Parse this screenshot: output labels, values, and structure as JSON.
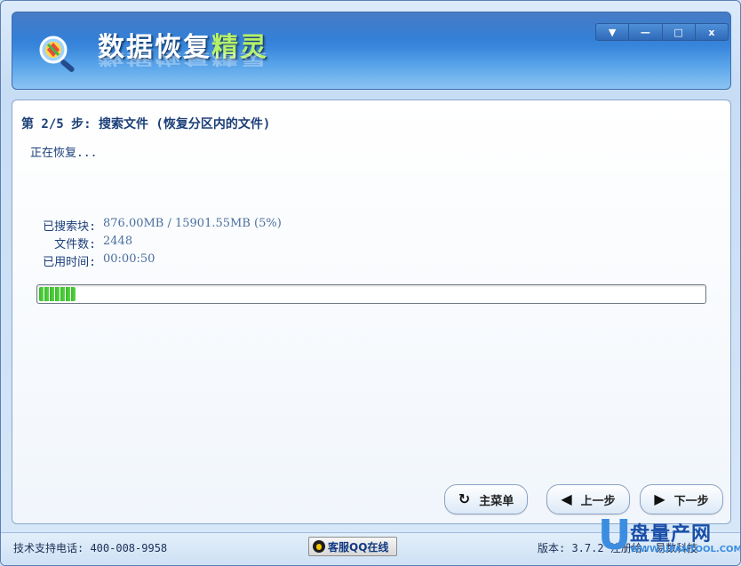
{
  "window": {
    "app_title_main": "数据恢复",
    "app_title_accent": "精灵",
    "controls": [
      "▼",
      "—",
      "□",
      "x"
    ]
  },
  "step": {
    "title": "第 2/5 步: 搜索文件 (恢复分区内的文件)",
    "status": "正在恢复..."
  },
  "info": {
    "searched_label": "已搜索块:",
    "searched_value": "876.00MB / 15901.55MB (5%)",
    "files_label": "文件数:",
    "files_value": "2448",
    "elapsed_label": "已用时间:",
    "elapsed_value": "00:00:50"
  },
  "progress": {
    "fraction": 0.055
  },
  "buttons": {
    "main_menu": "主菜单",
    "prev": "上一步",
    "next": "下一步"
  },
  "footer": {
    "support": "技术支持电话: 400-008-9958",
    "qq": "客服QQ在线",
    "version": "版本: 3.7.2  注册给: 易数科技"
  },
  "watermark": {
    "letter": "U",
    "text": "盘量产网",
    "url": "WWW.UPANTOOL.COM"
  },
  "colors": {
    "accent": "#b6f06a",
    "title_text": "#1c3f78",
    "progress": "#3bb82b"
  }
}
